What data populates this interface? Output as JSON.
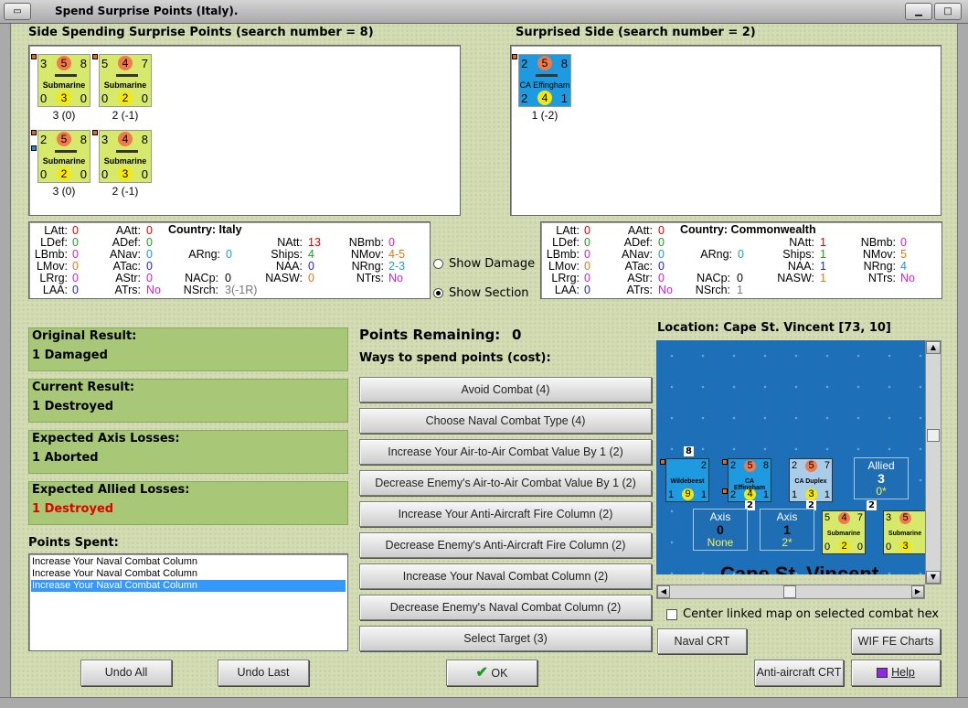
{
  "window": {
    "title": "Spend Surprise Points (Italy)."
  },
  "spending": {
    "header": "Side Spending Surprise Points (search number = 8)",
    "units": [
      {
        "name": "Submarine",
        "top_left": "3",
        "top_circle": "5",
        "top_right": "8",
        "bot_left": "0",
        "bot_circle": "3",
        "bot_right": "0",
        "caption": "3 (0)"
      },
      {
        "name": "Submarine",
        "top_left": "5",
        "top_circle": "4",
        "top_right": "7",
        "bot_left": "0",
        "bot_circle": "2",
        "bot_right": "0",
        "caption": "2 (-1)"
      },
      {
        "name": "Submarine",
        "top_left": "2",
        "top_circle": "5",
        "top_right": "8",
        "bot_left": "0",
        "bot_circle": "2",
        "bot_right": "0",
        "caption": "3 (0)"
      },
      {
        "name": "Submarine",
        "top_left": "3",
        "top_circle": "4",
        "top_right": "8",
        "bot_left": "0",
        "bot_circle": "3",
        "bot_right": "0",
        "caption": "2 (-1)"
      }
    ]
  },
  "surprised": {
    "header": "Surprised Side (search number = 2)",
    "units": [
      {
        "name": "CA Effingham",
        "top_left": "2",
        "top_circle": "5",
        "top_right": "8",
        "bot_left": "2",
        "bot_circle": "4",
        "bot_right": "1",
        "caption": "1 (-2)"
      }
    ]
  },
  "italy_stats": {
    "country_label": "Country:",
    "country": "Italy",
    "latt": "0",
    "ldef": "0",
    "lbmb": "0",
    "lmov": "0",
    "lrrg": "0",
    "laa": "0",
    "aatt": "0",
    "adef": "0",
    "anav": "0",
    "atac": "0",
    "astr": "0",
    "atrs": "No",
    "arng": "0",
    "nacp": "0",
    "nsrch": "3(-1R)",
    "natt": "13",
    "ships": "4",
    "naa": "0",
    "nasw": "0",
    "nbmb": "0",
    "nmov": "4-5",
    "nrng": "2-3",
    "ntrs": "No"
  },
  "commonwealth_stats": {
    "country_label": "Country:",
    "country": "Commonwealth",
    "latt": "0",
    "ldef": "0",
    "lbmb": "0",
    "lmov": "0",
    "lrrg": "0",
    "laa": "0",
    "aatt": "0",
    "adef": "0",
    "anav": "0",
    "atac": "0",
    "astr": "0",
    "atrs": "No",
    "arng": "0",
    "nacp": "0",
    "nsrch": "1",
    "natt": "1",
    "ships": "1",
    "naa": "1",
    "nasw": "1",
    "nbmb": "0",
    "nmov": "5",
    "nrng": "4",
    "ntrs": "No"
  },
  "stat_labels": {
    "latt": "LAtt:",
    "ldef": "LDef:",
    "lbmb": "LBmb:",
    "lmov": "LMov:",
    "lrrg": "LRrg:",
    "laa": "LAA:",
    "aatt": "AAtt:",
    "adef": "ADef:",
    "anav": "ANav:",
    "atac": "ATac:",
    "astr": "AStr:",
    "atrs": "ATrs:",
    "arng": "ARng:",
    "nacp": "NACp:",
    "nsrch": "NSrch:",
    "natt": "NAtt:",
    "ships": "Ships:",
    "naa": "NAA:",
    "nasw": "NASW:",
    "nbmb": "NBmb:",
    "nmov": "NMov:",
    "nrng": "NRng:",
    "ntrs": "NTrs:"
  },
  "options": {
    "show_damage": "Show Damage",
    "show_section": "Show Section",
    "selected": "show_section"
  },
  "results": [
    {
      "title": "Original Result:",
      "value": "1 Damaged",
      "color": "#000000"
    },
    {
      "title": "Current Result:",
      "value": "1 Destroyed",
      "color": "#000000"
    },
    {
      "title": "Expected Axis Losses:",
      "value": "1 Aborted",
      "color": "#000000"
    },
    {
      "title": "Expected Allied Losses:",
      "value": "1 Destroyed",
      "color": "#e00000"
    }
  ],
  "points_spent": {
    "title": "Points Spent:",
    "items": [
      "Increase Your Naval Combat Column",
      "Increase Your Naval Combat Column",
      "Increase Your Naval Combat Column"
    ],
    "selected_index": 2
  },
  "points_remaining": {
    "label": "Points Remaining:",
    "value": "0"
  },
  "ways_label": "Ways to spend points (cost):",
  "actions": [
    "Avoid Combat (4)",
    "Choose Naval Combat Type (4)",
    "Increase Your Air-to-Air Combat Value By 1 (2)",
    "Decrease Enemy's Air-to-Air Combat Value By 1 (2)",
    "Increase Your Anti-Aircraft Fire Column (2)",
    "Decrease Enemy's Anti-Aircraft Fire Column (2)",
    "Increase Your Naval Combat Column (2)",
    "Decrease Enemy's Naval Combat Column (2)",
    "Select Target (3)"
  ],
  "location": {
    "label": "Location: Cape St. Vincent [73, 10]",
    "map_name": "Cape St. Vincent",
    "stack_counts": [
      "8",
      "2",
      "2",
      "2"
    ],
    "map_units": [
      {
        "name": "Wildebeest",
        "top_left": "",
        "top_circle": "",
        "top_right": "2",
        "bot_left": "1",
        "bot_circle": "9",
        "bot_right": "1"
      },
      {
        "name": "CA Effingham",
        "top_left": "2",
        "top_circle": "5",
        "top_right": "8",
        "bot_left": "2",
        "bot_circle": "4",
        "bot_right": "1"
      },
      {
        "name": "CA Duplex",
        "top_left": "2",
        "top_circle": "5",
        "top_right": "7",
        "bot_left": "1",
        "bot_circle": "3",
        "bot_right": "1"
      },
      {
        "name": "Submarine",
        "top_left": "5",
        "top_circle": "4",
        "top_right": "7",
        "bot_left": "0",
        "bot_circle": "2",
        "bot_right": "0"
      },
      {
        "name": "Submarine",
        "top_left": "3",
        "top_circle": "5",
        "top_right": "",
        "bot_left": "0",
        "bot_circle": "3",
        "bot_right": ""
      }
    ],
    "tiles": [
      {
        "title": "Allied",
        "value": "3",
        "sub": "0*"
      },
      {
        "title": "Axis",
        "value": "0",
        "sub": "None"
      },
      {
        "title": "Axis",
        "value": "1",
        "sub": "2*"
      }
    ],
    "center_linked_label": "Center linked map on selected combat hex"
  },
  "buttons": {
    "naval_crt": "Naval CRT",
    "wif_fe_charts": "WIF FE Charts",
    "anti_aircraft_crt": "Anti-aircraft CRT",
    "help": "Help",
    "undo_all": "Undo All",
    "undo_last": "Undo Last",
    "ok": "OK"
  },
  "colors": {
    "panel_green": "#a8c777",
    "map_sea": "#1d70b8",
    "counter_yellow": "#d6e96a",
    "counter_blue": "#1e9be0",
    "selection": "#3399ff"
  }
}
